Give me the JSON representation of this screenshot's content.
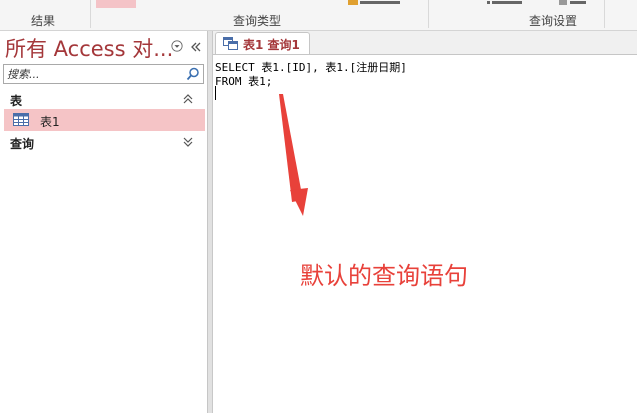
{
  "ribbon": {
    "groups": [
      {
        "label": "结果"
      },
      {
        "label": "查询类型"
      },
      {
        "label": "查询设置"
      }
    ]
  },
  "nav": {
    "title": "所有 Access 对...",
    "search_placeholder": "搜索...",
    "sections": [
      {
        "label": "表",
        "state": "expanded",
        "items": [
          {
            "label": "表1",
            "icon": "table-icon"
          }
        ]
      },
      {
        "label": "查询",
        "state": "collapsed",
        "items": []
      }
    ]
  },
  "tab": {
    "label": "表1 查询1",
    "icon": "query-icon"
  },
  "editor": {
    "lines": [
      "SELECT 表1.[ID], 表1.[注册日期]",
      "FROM 表1;"
    ]
  },
  "annotation": {
    "text": "默认的查询语句",
    "color": "#e8413a"
  },
  "colors": {
    "accent": "#a4373a",
    "selection": "#f5c4c6"
  }
}
